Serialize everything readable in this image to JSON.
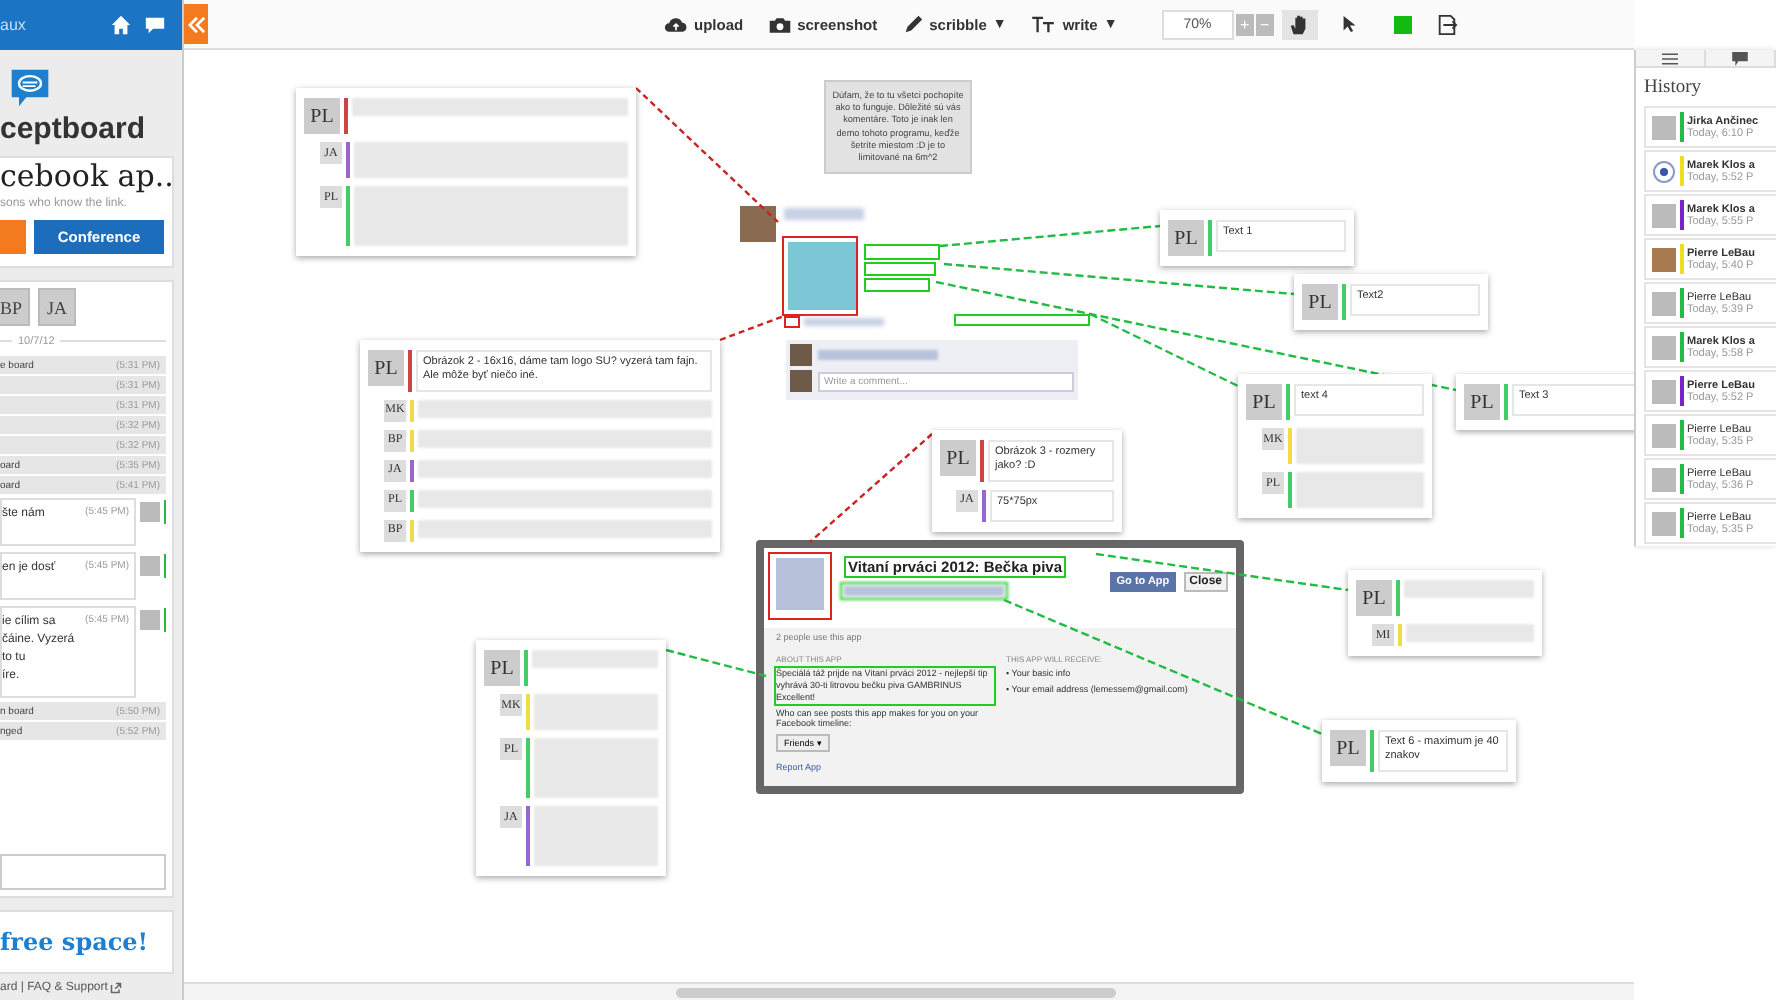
{
  "sidebar": {
    "header_title": "aux",
    "logo_text": "ceptboard",
    "board_title": "cebook ap..",
    "share_note": "sons who know the link.",
    "conference_button": "Conference",
    "participants": [
      {
        "initials": "BP"
      },
      {
        "initials": "JA"
      }
    ],
    "date": "10/7/12",
    "activity": [
      {
        "kind": "event",
        "text": "e board",
        "time": "(5:31 PM)"
      },
      {
        "kind": "event",
        "time": "(5:31 PM)"
      },
      {
        "kind": "event",
        "time": "(5:31 PM)"
      },
      {
        "kind": "event",
        "time": "(5:32 PM)"
      },
      {
        "kind": "event",
        "time": "(5:32 PM)"
      },
      {
        "kind": "event",
        "text": "oard",
        "time": "(5:35 PM)"
      },
      {
        "kind": "event",
        "text": "oard",
        "time": "(5:41 PM)"
      },
      {
        "kind": "comment",
        "text": "šte nám",
        "time": "(5:45 PM)",
        "color": "#22bb44"
      },
      {
        "kind": "comment",
        "text": "en je dosť",
        "time": "(5:45 PM)",
        "color": "#22bb44"
      },
      {
        "kind": "comment",
        "text": "ie cílim sa\nčáine. Vyzerá to tu\níre.",
        "time": "(5:45 PM)",
        "color": "#22bb44"
      },
      {
        "kind": "event",
        "text": "n board",
        "time": "(5:50 PM)"
      },
      {
        "kind": "event",
        "text": "nged",
        "time": "(5:52 PM)"
      }
    ],
    "free_space": "free space!",
    "footer": "ard | FAQ & Support"
  },
  "toolbar": {
    "tools": [
      {
        "kind": "upload",
        "label": "upload"
      },
      {
        "kind": "screenshot",
        "label": "screenshot"
      },
      {
        "kind": "scribble",
        "label": "scribble",
        "caret": "▼"
      },
      {
        "kind": "write",
        "label": "write",
        "caret": "▼"
      }
    ],
    "zoom": "70%",
    "zoom_in": "+",
    "zoom_out": "−",
    "color": "#11bb11"
  },
  "canvas": {
    "info_note": "Dúfam, že to tu všetci pochopíte ako to funguje. Dôležité sú vás komentáre. Toto je inak len demo tohoto programu, keďže šetríte miestom :D je to limitované na 6m^2",
    "notes": [
      {
        "comments": [
          {
            "initials": "PL",
            "color": "#cc4444"
          },
          {
            "initials": "JA",
            "color": "#9966cc"
          },
          {
            "initials": "PL",
            "color": "#44cc66"
          }
        ]
      },
      {
        "comments": [
          {
            "initials": "PL",
            "color": "#cc4444",
            "text": "Obrázok 2 - 16x16, dáme tam logo SU? vyzerá tam fajn. Ale môže byť niečo iné."
          },
          {
            "initials": "MK",
            "color": "#eedd44"
          },
          {
            "initials": "BP",
            "color": "#eedd44"
          },
          {
            "initials": "JA",
            "color": "#9966cc"
          },
          {
            "initials": "PL",
            "color": "#44cc66"
          },
          {
            "initials": "BP",
            "color": "#eedd44"
          }
        ]
      },
      {
        "comments": [
          {
            "initials": "PL",
            "color": "#44cc66"
          },
          {
            "initials": "MK",
            "color": "#eedd44"
          },
          {
            "initials": "PL",
            "color": "#44cc66"
          },
          {
            "initials": "JA",
            "color": "#9966cc"
          }
        ]
      },
      {
        "comments": [
          {
            "initials": "PL",
            "color": "#cc4444",
            "text": "Obrázok 3 - rozmery jako? :D"
          },
          {
            "initials": "JA",
            "color": "#9966cc",
            "text": "75*75px"
          }
        ]
      },
      {
        "comments": [
          {
            "initials": "PL",
            "color": "#44cc66",
            "text": "Text 1"
          }
        ]
      },
      {
        "comments": [
          {
            "initials": "PL",
            "color": "#44cc66",
            "text": "Text2"
          }
        ]
      },
      {
        "comments": [
          {
            "initials": "PL",
            "color": "#44cc66",
            "text": "text 4"
          },
          {
            "initials": "MK",
            "color": "#eedd44"
          },
          {
            "initials": "PL",
            "color": "#44cc66"
          }
        ]
      },
      {
        "comments": [
          {
            "initials": "PL",
            "color": "#44cc66",
            "text": "Text 3"
          }
        ]
      },
      {
        "comments": [
          {
            "initials": "PL",
            "color": "#44cc66"
          },
          {
            "initials": "MI",
            "color": "#eedd44"
          }
        ]
      },
      {
        "comments": [
          {
            "initials": "PL",
            "color": "#44cc66",
            "text": "Text 6 - maximum je 40 znakov"
          }
        ]
      }
    ],
    "post": {
      "comment_placeholder": "Write a comment..."
    },
    "dialog": {
      "title": "Vitaní prváci 2012: Bečka piva",
      "go_button": "Go to App",
      "close_button": "Close",
      "users": "2 people use this app",
      "about_heading": "ABOUT THIS APP",
      "about_text": "Špeciálá táž prijde na Vitaní prváci 2012 - nejlepší tip vyhrává 30-ti litrovou bečku piva GAMBRINUS Excellent!",
      "receive_heading": "THIS APP WILL RECEIVE:",
      "receive_items": [
        "Your basic info",
        "Your email address (lemessem@gmail.com)"
      ],
      "audience_text": "Who can see posts this app makes for you on your Facebook timeline:",
      "audience": "Friends",
      "audience_caret": "▾",
      "bullet": "•",
      "report": "Report App"
    }
  },
  "history": {
    "title": "History",
    "items": [
      {
        "name": "Jirka Ančinec",
        "time": "Today, 6:10 P",
        "color": "#22bb44",
        "unread": true,
        "kind": "blank"
      },
      {
        "name": "Marek Klos a",
        "time": "Today, 5:52 P",
        "color": "#eedd22",
        "unread": true,
        "kind": "icon"
      },
      {
        "name": "Marek Klos a",
        "time": "Today, 5:55 P",
        "color": "#7722cc",
        "unread": true,
        "kind": "blank"
      },
      {
        "name": "Pierre LeBau",
        "time": "Today, 5:40 P",
        "color": "#eedd22",
        "unread": true,
        "kind": "photo"
      },
      {
        "name": "Pierre LeBau",
        "time": "Today, 5:39 P",
        "color": "#22bb44",
        "unread": false,
        "kind": "blank"
      },
      {
        "name": "Marek Klos a",
        "time": "Today, 5:58 P",
        "color": "#22bb44",
        "unread": true,
        "kind": "blank"
      },
      {
        "name": "Pierre LeBau",
        "time": "Today, 5:52 P",
        "color": "#7722cc",
        "unread": true,
        "kind": "blank"
      },
      {
        "name": "Pierre LeBau",
        "time": "Today, 5:35 P",
        "color": "#22bb44",
        "unread": false,
        "kind": "blank"
      },
      {
        "name": "Pierre LeBau",
        "time": "Today, 5:36 P",
        "color": "#22bb44",
        "unread": false,
        "kind": "blank"
      },
      {
        "name": "Pierre LeBau",
        "time": "Today, 5:35 P",
        "color": "#22bb44",
        "unread": false,
        "kind": "blank"
      }
    ]
  }
}
